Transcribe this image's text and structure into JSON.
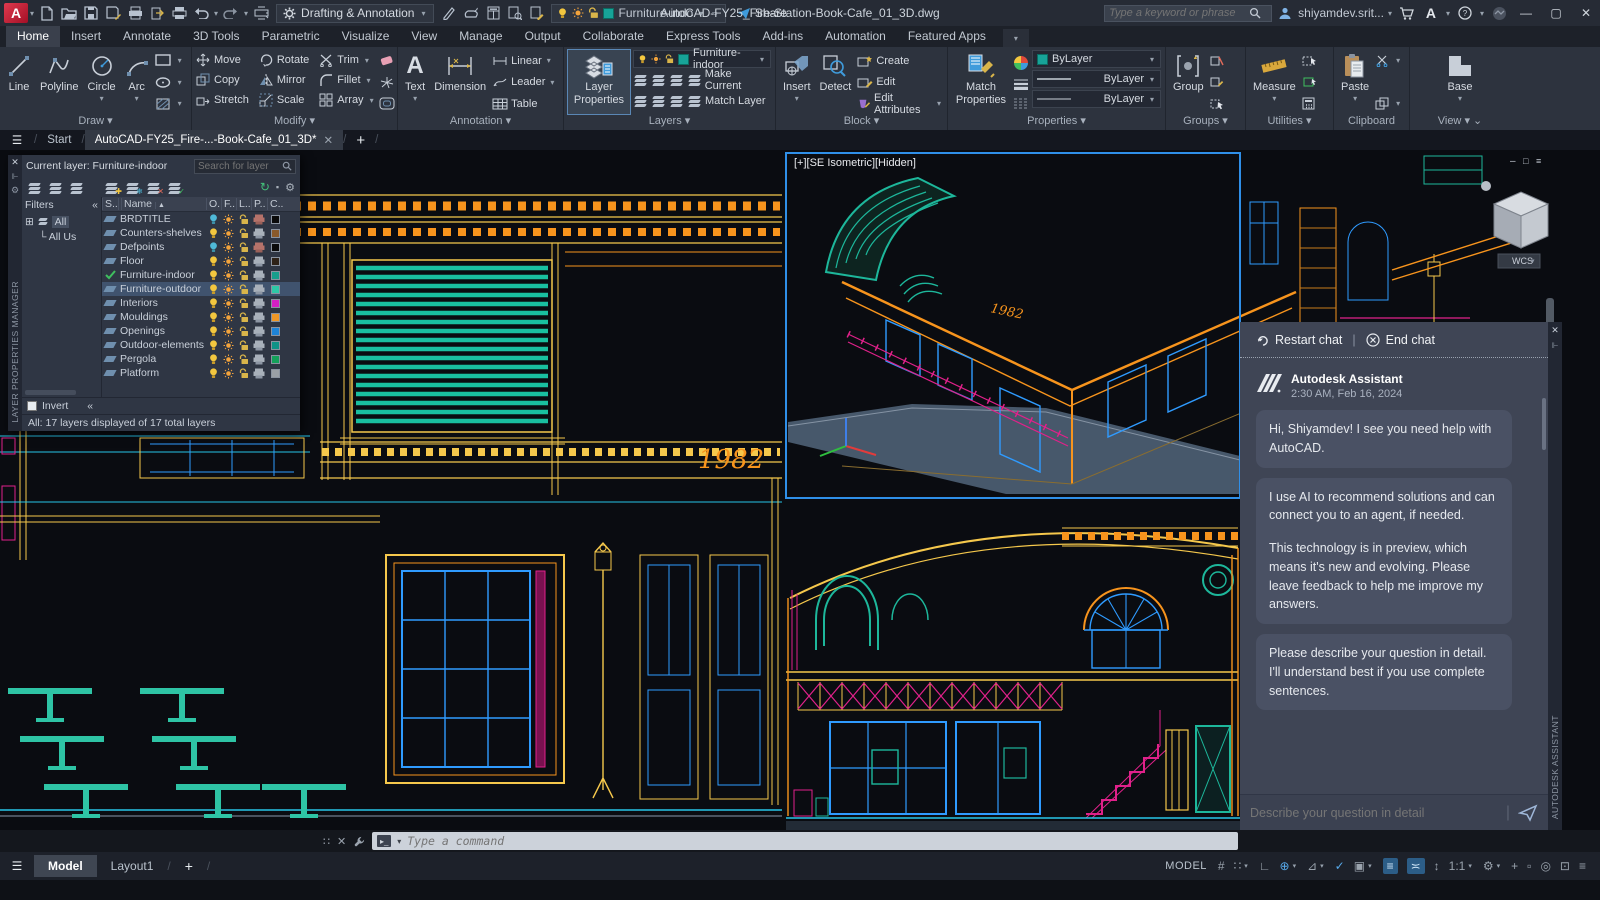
{
  "titlebar": {
    "app_initial": "A",
    "workspace": "Drafting & Annotation",
    "quick_layer": "Furniture-indo",
    "share_label": "Share",
    "doc_title": "AutoCAD-FY25_Fire-Station-Book-Cafe_01_3D.dwg",
    "search_placeholder": "Type a keyword or phrase",
    "user": "shiyamdev.srit..."
  },
  "ribbon": {
    "tabs": [
      {
        "label": "Home",
        "active": true
      },
      {
        "label": "Insert"
      },
      {
        "label": "Annotate"
      },
      {
        "label": "3D Tools"
      },
      {
        "label": "Parametric"
      },
      {
        "label": "Visualize"
      },
      {
        "label": "View"
      },
      {
        "label": "Manage"
      },
      {
        "label": "Output"
      },
      {
        "label": "Collaborate"
      },
      {
        "label": "Express Tools"
      },
      {
        "label": "Add-ins"
      },
      {
        "label": "Automation"
      },
      {
        "label": "Featured Apps"
      }
    ],
    "panels": {
      "draw": {
        "title": "Draw",
        "tools": [
          "Line",
          "Polyline",
          "Circle",
          "Arc"
        ]
      },
      "modify": {
        "title": "Modify",
        "tools": [
          "Move",
          "Rotate",
          "Trim",
          "Copy",
          "Mirror",
          "Fillet",
          "Stretch",
          "Scale",
          "Array"
        ]
      },
      "annotation": {
        "title": "Annotation",
        "tools": [
          "Text",
          "Dimension",
          "Linear",
          "Leader",
          "Table"
        ]
      },
      "layers": {
        "title": "Layers",
        "layer_properties": "Layer Properties",
        "current_layer": "Furniture-indoor",
        "make_current": "Make Current",
        "match_layer": "Match Layer"
      },
      "block": {
        "title": "Block",
        "tools": [
          "Insert",
          "Detect",
          "Create",
          "Edit",
          "Edit Attributes"
        ]
      },
      "properties": {
        "title": "Properties",
        "match_properties": "Match Properties",
        "color": "ByLayer",
        "lineweight": "ByLayer",
        "linetype": "ByLayer"
      },
      "groups": {
        "title": "Groups",
        "group": "Group"
      },
      "utilities": {
        "title": "Utilities",
        "measure": "Measure"
      },
      "clipboard": {
        "title": "Clipboard",
        "paste": "Paste"
      },
      "view": {
        "title": "View",
        "base": "Base"
      }
    }
  },
  "file_tabs": {
    "start": "Start",
    "active_doc": "AutoCAD-FY25_Fire-...-Book-Cafe_01_3D*"
  },
  "layer_palette": {
    "vertical_title": "LAYER PROPERTIES MANAGER",
    "current_layer_label": "Current layer: Furniture-indoor",
    "search_placeholder": "Search for layer",
    "filters_label": "Filters",
    "tree_all": "All",
    "tree_all_used": "All Us",
    "columns": [
      "S..",
      "Name",
      "O..",
      "F..",
      "L..",
      "P..",
      "C.."
    ],
    "layers": [
      {
        "name": "BRDTITLE",
        "on": false,
        "plot": false,
        "color": "#0a0a0a"
      },
      {
        "name": "Counters-shelves",
        "on": true,
        "color": "#8a5a2b"
      },
      {
        "name": "Defpoints",
        "on": false,
        "plot": false,
        "color": "#0a0a0a"
      },
      {
        "name": "Floor",
        "on": true,
        "color": "#2e2218"
      },
      {
        "name": "Furniture-indoor",
        "on": true,
        "current": true,
        "color": "#169e8c"
      },
      {
        "name": "Furniture-outdoor",
        "on": true,
        "selected": true,
        "color": "#2ec9a7"
      },
      {
        "name": "Interiors",
        "on": true,
        "color": "#d41fc4"
      },
      {
        "name": "Mouldings",
        "on": true,
        "color": "#ef9726"
      },
      {
        "name": "Openings",
        "on": true,
        "color": "#1d83d8"
      },
      {
        "name": "Outdoor-elements",
        "on": true,
        "color": "#0f9287"
      },
      {
        "name": "Pergola",
        "on": true,
        "color": "#14a05a"
      },
      {
        "name": "Platform",
        "on": true,
        "color": "#9aa0a6"
      }
    ],
    "invert_label": "Invert",
    "status": "All: 17 layers displayed of 17 total layers"
  },
  "viewport": {
    "label": "[+][SE Isometric][Hidden]",
    "wcs": "WCS",
    "year_text": "1982"
  },
  "assistant": {
    "restart": "Restart chat",
    "end": "End chat",
    "vertical_title": "AUTODESK ASSISTANT",
    "sender": "Autodesk Assistant",
    "timestamp": "2:30 AM, Feb 16, 2024",
    "messages": [
      {
        "paragraphs": [
          "Hi, Shiyamdev! I see you need help with AutoCAD."
        ]
      },
      {
        "paragraphs": [
          "I use AI to recommend solutions and can connect you to an agent, if needed.",
          "This technology is in preview, which means it's new and evolving. Please leave feedback to help me improve my answers."
        ]
      },
      {
        "paragraphs": [
          "Please describe your question in detail. I'll understand best if you use complete sentences."
        ]
      }
    ],
    "input_placeholder": "Describe your question in detail"
  },
  "command_line": {
    "placeholder": "Type a command"
  },
  "bottom_bar": {
    "model_tab": "Model",
    "layout_tab": "Layout1",
    "mode": "MODEL",
    "status_icons": [
      {
        "glyph": "#",
        "name": "grid-icon"
      },
      {
        "glyph": "∷",
        "name": "snap-mode-icon",
        "caret": true
      },
      {
        "glyph": "∟",
        "name": "ortho-icon"
      },
      {
        "glyph": "⊕",
        "name": "polar-tracking-icon",
        "on": true,
        "caret": true
      },
      {
        "glyph": "⊿",
        "name": "isodraft-icon",
        "caret": true
      },
      {
        "glyph": "✓",
        "name": "osnap-tracking-icon",
        "on": true
      },
      {
        "glyph": "▣",
        "name": "object-snap-icon",
        "caret": true
      },
      {
        "glyph": "≡",
        "name": "lineweight-icon",
        "onbg": true
      },
      {
        "glyph": "≍",
        "name": "transparency-icon",
        "onbg": true
      },
      {
        "glyph": "↕",
        "name": "selection-cycling-icon"
      },
      {
        "glyph": "1:1",
        "name": "annotation-scale",
        "caret": true
      },
      {
        "glyph": "⚙",
        "name": "workspace-gear-icon",
        "caret": true
      },
      {
        "glyph": "+",
        "name": "customize-plus-icon"
      },
      {
        "glyph": "▫",
        "name": "annotation-monitor-icon"
      },
      {
        "glyph": "◎",
        "name": "quick-properties-icon"
      },
      {
        "glyph": "⊡",
        "name": "clean-screen-icon"
      },
      {
        "glyph": "≡",
        "name": "customization-icon"
      }
    ]
  },
  "colors": {
    "accent_blue": "#2f8fe8",
    "cad_yellow": "#f5c84c",
    "cad_orange": "#f7941d",
    "cad_teal": "#1db79b",
    "cad_blue": "#2f9bff",
    "cad_magenta": "#e0218a",
    "cad_cyan": "#27c5e8"
  }
}
